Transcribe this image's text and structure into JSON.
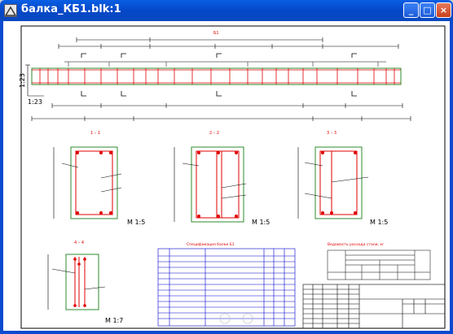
{
  "window": {
    "title": "балка_КБ1.blk:1",
    "minimize_symbol": "_",
    "maximize_symbol": "□",
    "close_symbol": "×"
  },
  "drawing": {
    "scale_main": "1:23",
    "scale_left": "1:23",
    "section_labels": [
      "1 – 1",
      "2 – 2",
      "3 – 3",
      "4 – 4"
    ],
    "section_scales": [
      "М 1:5",
      "М 1:5",
      "М 1:5",
      "М 1:7"
    ],
    "spec_title": "Спецификация балки Б1",
    "statement_title": "Ведомость расхода стали, кг",
    "top_label": "Б1"
  },
  "colors": {
    "titlebar": "#0a4fd6",
    "outline_green": "#2e8b2e",
    "rebar_red": "#e00000",
    "line_black": "#000000",
    "table_blue": "#0000cc"
  }
}
